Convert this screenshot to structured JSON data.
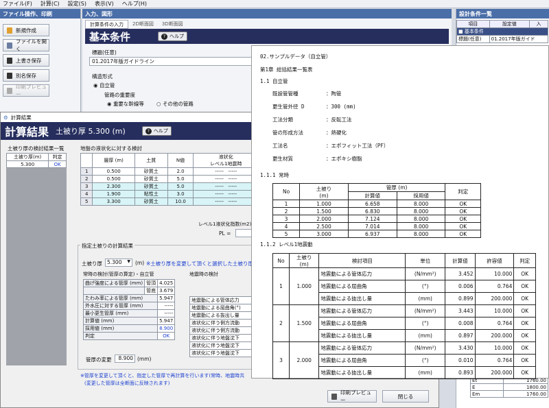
{
  "menu": {
    "items": [
      "ファイル(F)",
      "計算(C)",
      "設定(S)",
      "表示(V)",
      "ヘルプ(H)"
    ]
  },
  "left_panel": {
    "title": "ファイル操作、印刷",
    "buttons": [
      "新規作成",
      "ファイルを開く",
      "上書き保存",
      "別名保存",
      "印刷プレビュー"
    ]
  },
  "input_panel": {
    "title": "入力、図形",
    "tabs": [
      "計算条件の入力",
      "2D断面図",
      "3D断面図"
    ],
    "header": "基本条件",
    "help": "ヘルプ",
    "title_label": "標題(任意)",
    "title_value": "01.2017年版ガイドライン",
    "structure_label": "構造形式",
    "structure_option": "自立管",
    "importance_label": "管路の重要度",
    "importance_options": [
      "重要な幹線等",
      "その他の管路"
    ]
  },
  "settings_panel": {
    "title": "設計条件一覧",
    "col1": "項目",
    "col2": "設定値",
    "col3": "入",
    "rows": [
      [
        "■ 基本条件",
        "",
        ""
      ],
      [
        "標題(任意)",
        "01.2017年版ガイド",
        ""
      ]
    ],
    "bottom_rows": [
      [
        "Et",
        "1760.00"
      ],
      [
        "E",
        "1800.00"
      ],
      [
        "Em",
        "1760.00"
      ]
    ]
  },
  "result_window": {
    "window_title": "計算結果",
    "header": "計算結果",
    "subtitle": "土被り厚 5.300 (m)",
    "help": "ヘルプ",
    "cover_list": {
      "title": "土被り厚の検討結果一覧",
      "cols": [
        "土被り厚(m)",
        "判定"
      ],
      "rows": [
        [
          "5.300",
          "OK"
        ]
      ]
    },
    "liq": {
      "title": "地盤の液状化に対する検討",
      "cols": [
        "",
        "層厚 (m)",
        "土質",
        "N値"
      ],
      "extra_col": "液状化",
      "extra_sub": "レベル1地震時",
      "rows": [
        [
          "1",
          "0.500",
          "砂質土",
          "2.0"
        ],
        [
          "2",
          "0.500",
          "砂質土",
          "5.0"
        ],
        [
          "3",
          "2.300",
          "砂質土",
          "5.0"
        ],
        [
          "4",
          "1.900",
          "粘性土",
          "3.0"
        ],
        [
          "5",
          "3.300",
          "砂質土",
          "10.0"
        ]
      ],
      "index_label": "レベル1液状化指数(m2)",
      "pl_label": "PL ="
    },
    "spec": {
      "title": "指定土被りの計算結果",
      "cover_label": "土被り厚",
      "cover_value": "5.300",
      "unit": "(m)",
      "note": "※土被り厚を変更して頂くと選択した土被り厚で",
      "normal_title": "常時の検討(管厚の算定)・自立管",
      "rows": [
        [
          "曲げ強度による管厚 (mm)",
          "管頂",
          "4.025"
        ],
        [
          "",
          "管底",
          "3.679"
        ],
        [
          "たわみ率による管厚 (mm)",
          "",
          "5.947"
        ],
        [
          "外水圧に対する管厚 (mm)",
          "",
          "-----"
        ],
        [
          "最小更生管厚 (mm)",
          "",
          "-----"
        ],
        [
          "計算値 (mm)",
          "",
          "5.947"
        ],
        [
          "採用値 (mm)",
          "",
          "8.900"
        ],
        [
          "判定",
          "",
          "OK"
        ]
      ],
      "quake_title": "地震時の検討",
      "quake_rows": [
        "地震動による管体応力",
        "地震動による屈曲角(°)",
        "地震動による抜出し量",
        "液状化に伴う側方流動",
        "液状化に伴う側方流動",
        "液状化に伴う地盤沈下",
        "液状化に伴う地盤沈下",
        "液状化に伴う地盤沈下"
      ],
      "change_label": "管厚の変更",
      "change_value": "8.900",
      "change_unit": "(mm)"
    },
    "footnote1": "※管厚を変更して頂くと、指定した管厚で再計算を行います(常時、地震時共",
    "footnote2": "(変更した管厚は全断面に反映されます)",
    "print_btn": "印刷プレビュー",
    "close_btn": "閉じる"
  },
  "document": {
    "heading": "02.サンプルデータ（自立管）",
    "chapter": "第1章 総括結果一覧表",
    "s11": "1.1 自立管",
    "props": [
      [
        "既設管管種",
        "陶管"
      ],
      [
        "更生管外径 D",
        "300 (mm)"
      ],
      [
        "工法分類",
        "反転工法"
      ],
      [
        "管の形成方法",
        "熱硬化"
      ],
      [
        "工法名",
        "エポフィット工法（PF）"
      ],
      [
        "更生材質",
        "エポキシ樹脂"
      ]
    ],
    "s111": "1.1.1 常時",
    "t1": {
      "h_no": "No",
      "h_cover": "土被り",
      "h_cover_u": "(m)",
      "h_thick": "管厚 (m)",
      "h_calc": "計算値",
      "h_adopt": "採用値",
      "h_judge": "判定",
      "rows": [
        [
          "1",
          "1.000",
          "6.658",
          "8.000",
          "OK"
        ],
        [
          "2",
          "1.500",
          "6.830",
          "8.000",
          "OK"
        ],
        [
          "3",
          "2.000",
          "7.124",
          "8.000",
          "OK"
        ],
        [
          "4",
          "2.500",
          "7.014",
          "8.000",
          "OK"
        ],
        [
          "5",
          "3.000",
          "6.937",
          "8.000",
          "OK"
        ]
      ]
    },
    "s112": "1.1.2 レベル1地震動",
    "t2": {
      "h_no": "No",
      "h_cover": "土被り",
      "h_cover_u": "(m)",
      "h_item": "検討項目",
      "h_unit": "単位",
      "h_calc": "計算値",
      "h_allow": "許容値",
      "h_judge": "判定",
      "groups": [
        {
          "no": "1",
          "cover": "1.000",
          "rows": [
            [
              "地震動による管体応力",
              "(N/mm²)",
              "3.452",
              "10.000",
              "OK"
            ],
            [
              "地震動による屈曲角",
              "(°)",
              "0.006",
              "0.764",
              "OK"
            ],
            [
              "地震動による抜出し量",
              "(mm)",
              "0.899",
              "200.000",
              "OK"
            ]
          ]
        },
        {
          "no": "2",
          "cover": "1.500",
          "rows": [
            [
              "地震動による管体応力",
              "(N/mm²)",
              "3.443",
              "10.000",
              "OK"
            ],
            [
              "地震動による屈曲角",
              "(°)",
              "0.008",
              "0.764",
              "OK"
            ],
            [
              "地震動による抜出し量",
              "(mm)",
              "0.897",
              "200.000",
              "OK"
            ]
          ]
        },
        {
          "no": "3",
          "cover": "2.000",
          "rows": [
            [
              "地震動による管体応力",
              "(N/mm²)",
              "3.430",
              "10.000",
              "OK"
            ],
            [
              "地震動による屈曲角",
              "(°)",
              "0.010",
              "0.764",
              "OK"
            ],
            [
              "地震動による抜出し量",
              "(mm)",
              "0.893",
              "200.000",
              "OK"
            ]
          ]
        }
      ]
    }
  }
}
